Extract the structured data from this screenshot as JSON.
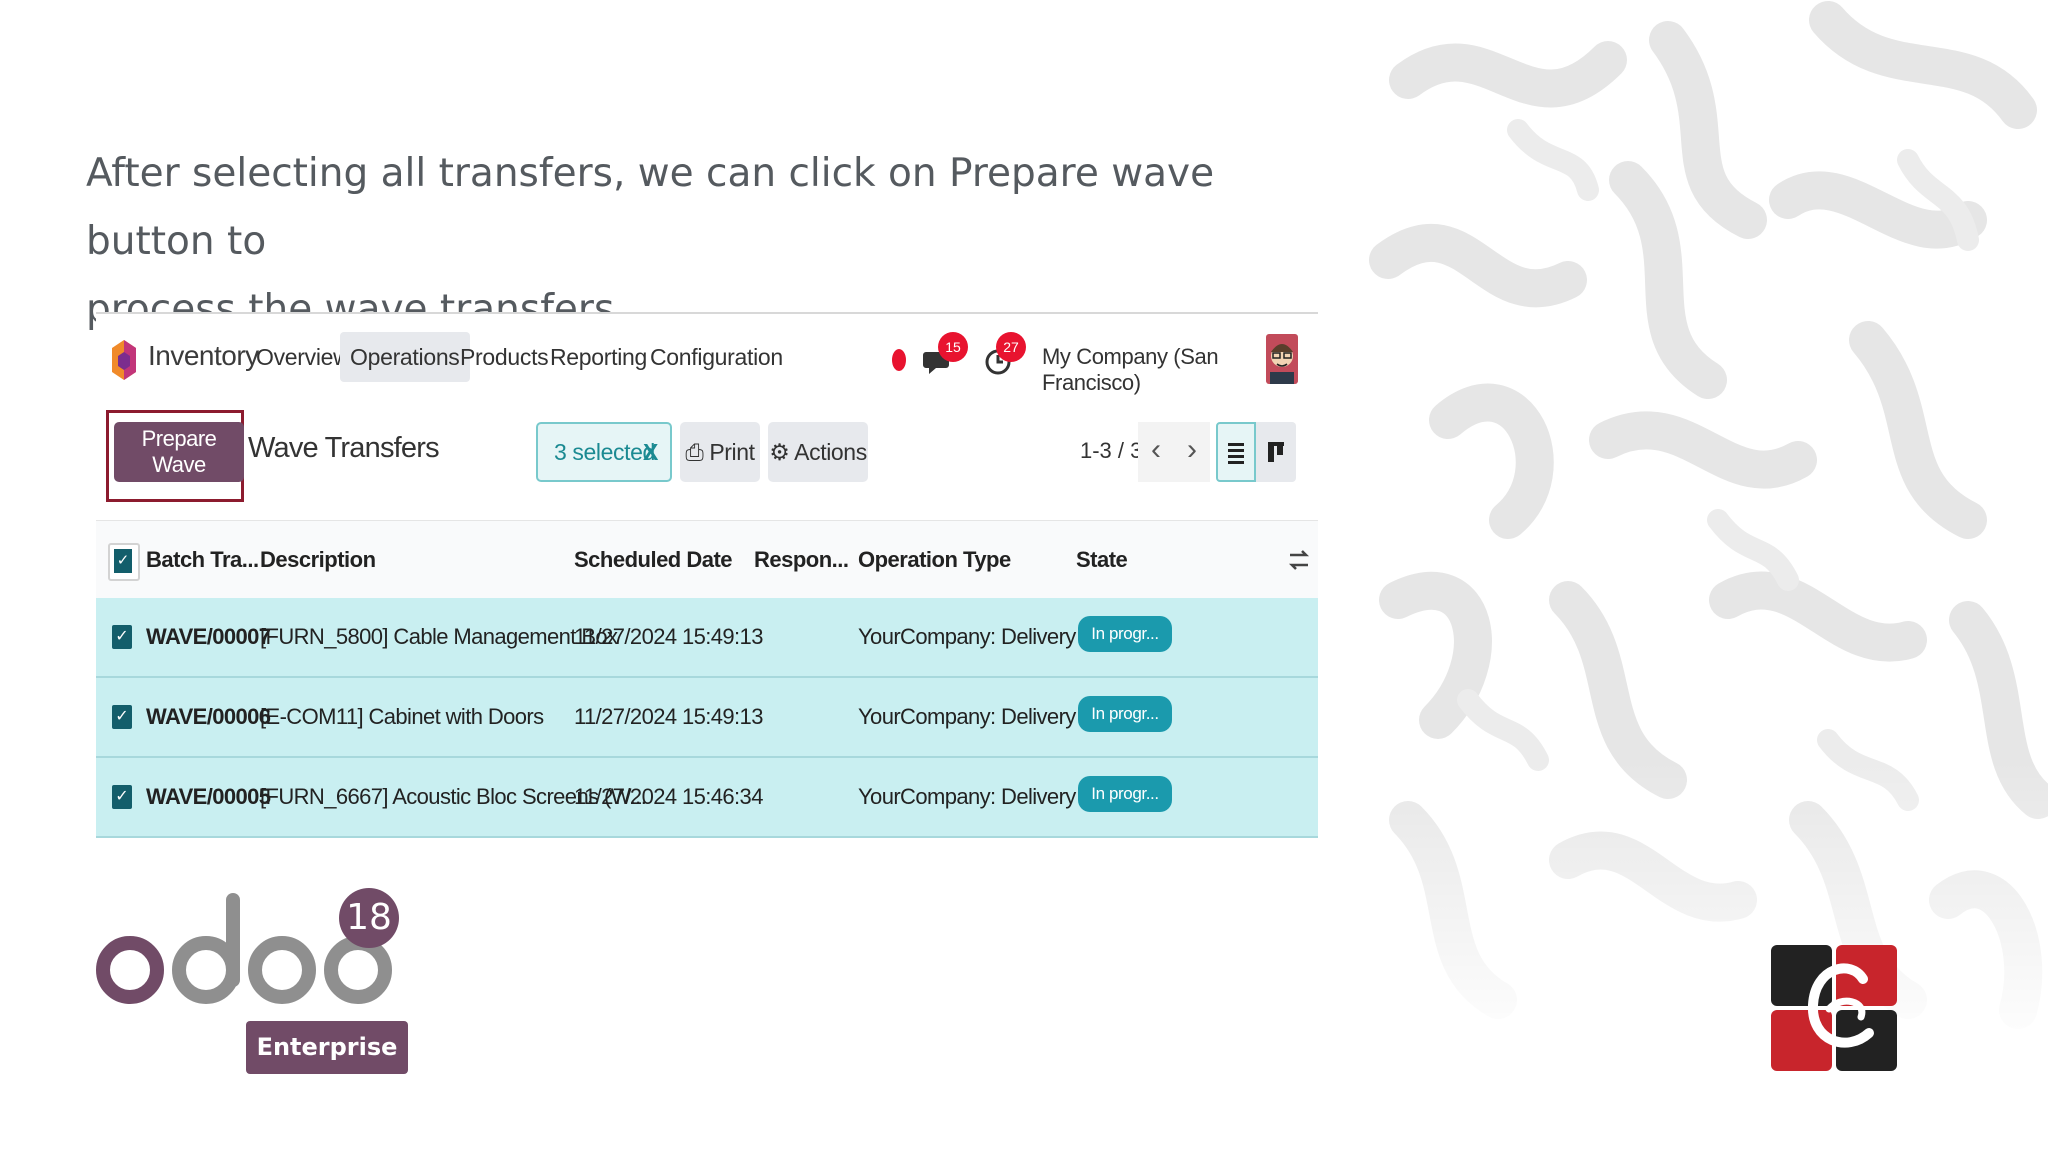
{
  "caption": {
    "line1": "After selecting all transfers, we can click on Prepare wave button to",
    "line2": "process the wave transfers."
  },
  "app": {
    "name": "Inventory",
    "menu": [
      "Overview",
      "Operations",
      "Products",
      "Reporting",
      "Configuration"
    ],
    "active_menu": "Operations",
    "messages_count": "15",
    "activities_count": "27",
    "company": "My Company (San Francisco)"
  },
  "controls": {
    "prepare_wave": "Prepare Wave",
    "view_title": "Wave Transfers",
    "selected": "3 selected",
    "clear": "X",
    "print": "Print",
    "actions": "Actions",
    "pager": "1-3 / 3"
  },
  "table": {
    "headers": [
      "Batch Tra...",
      "Description",
      "Scheduled Date",
      "Respon...",
      "Operation Type",
      "State"
    ],
    "rows": [
      {
        "batch": "WAVE/00007",
        "description": "[FURN_5800] Cable Management Box",
        "date": "11/27/2024 15:49:13",
        "responsible": "",
        "operation": "YourCompany: Delivery O...",
        "state": "In progr..."
      },
      {
        "batch": "WAVE/00006",
        "description": "[E-COM11] Cabinet with Doors",
        "date": "11/27/2024 15:49:13",
        "responsible": "",
        "operation": "YourCompany: Delivery O...",
        "state": "In progr..."
      },
      {
        "batch": "WAVE/00005",
        "description": "[FURN_6667] Acoustic Bloc Screens (W...",
        "date": "11/27/2024 15:46:34",
        "responsible": "",
        "operation": "YourCompany: Delivery O...",
        "state": "In progr..."
      }
    ]
  },
  "branding": {
    "product": "odoo",
    "version": "18",
    "edition": "Enterprise",
    "colors": {
      "primary": "#714b67",
      "teal": "#1b9aad",
      "row_selected": "#c9eff1",
      "highlight": "#8c1b2e"
    }
  },
  "icons": [
    "inventory-app-icon",
    "status-dot-icon",
    "chat-icon",
    "clock-icon",
    "print-icon",
    "gear-icon",
    "chevron-left-icon",
    "chevron-right-icon",
    "list-view-icon",
    "kanban-view-icon",
    "optional-columns-icon",
    "checkbox-icon"
  ]
}
